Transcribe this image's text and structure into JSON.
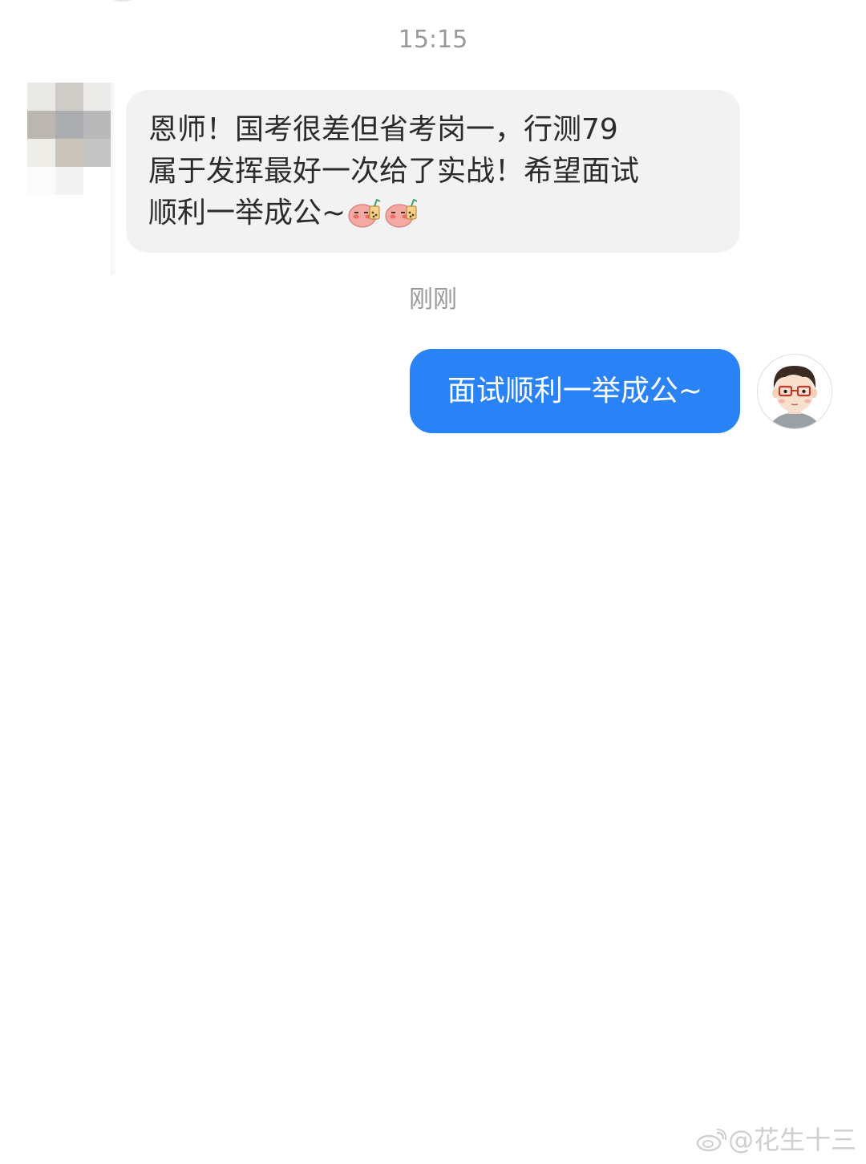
{
  "chat": {
    "timestamps": [
      "15:15",
      "刚刚"
    ],
    "incoming": {
      "lines": [
        "恩师！国考很差但省考岗一，行测79",
        "属于发挥最好一次给了实战！希望面试",
        "顺利一举成公~"
      ],
      "emojis": [
        "peach-sticker-icon",
        "peach-sticker-icon"
      ]
    },
    "outgoing": {
      "text": "面试顺利一举成公~"
    }
  },
  "watermark": {
    "text": "@花生十三"
  },
  "colors": {
    "outgoing_bubble": "#2a83f6",
    "incoming_bubble": "#f2f2f2",
    "timestamp": "#999999"
  }
}
